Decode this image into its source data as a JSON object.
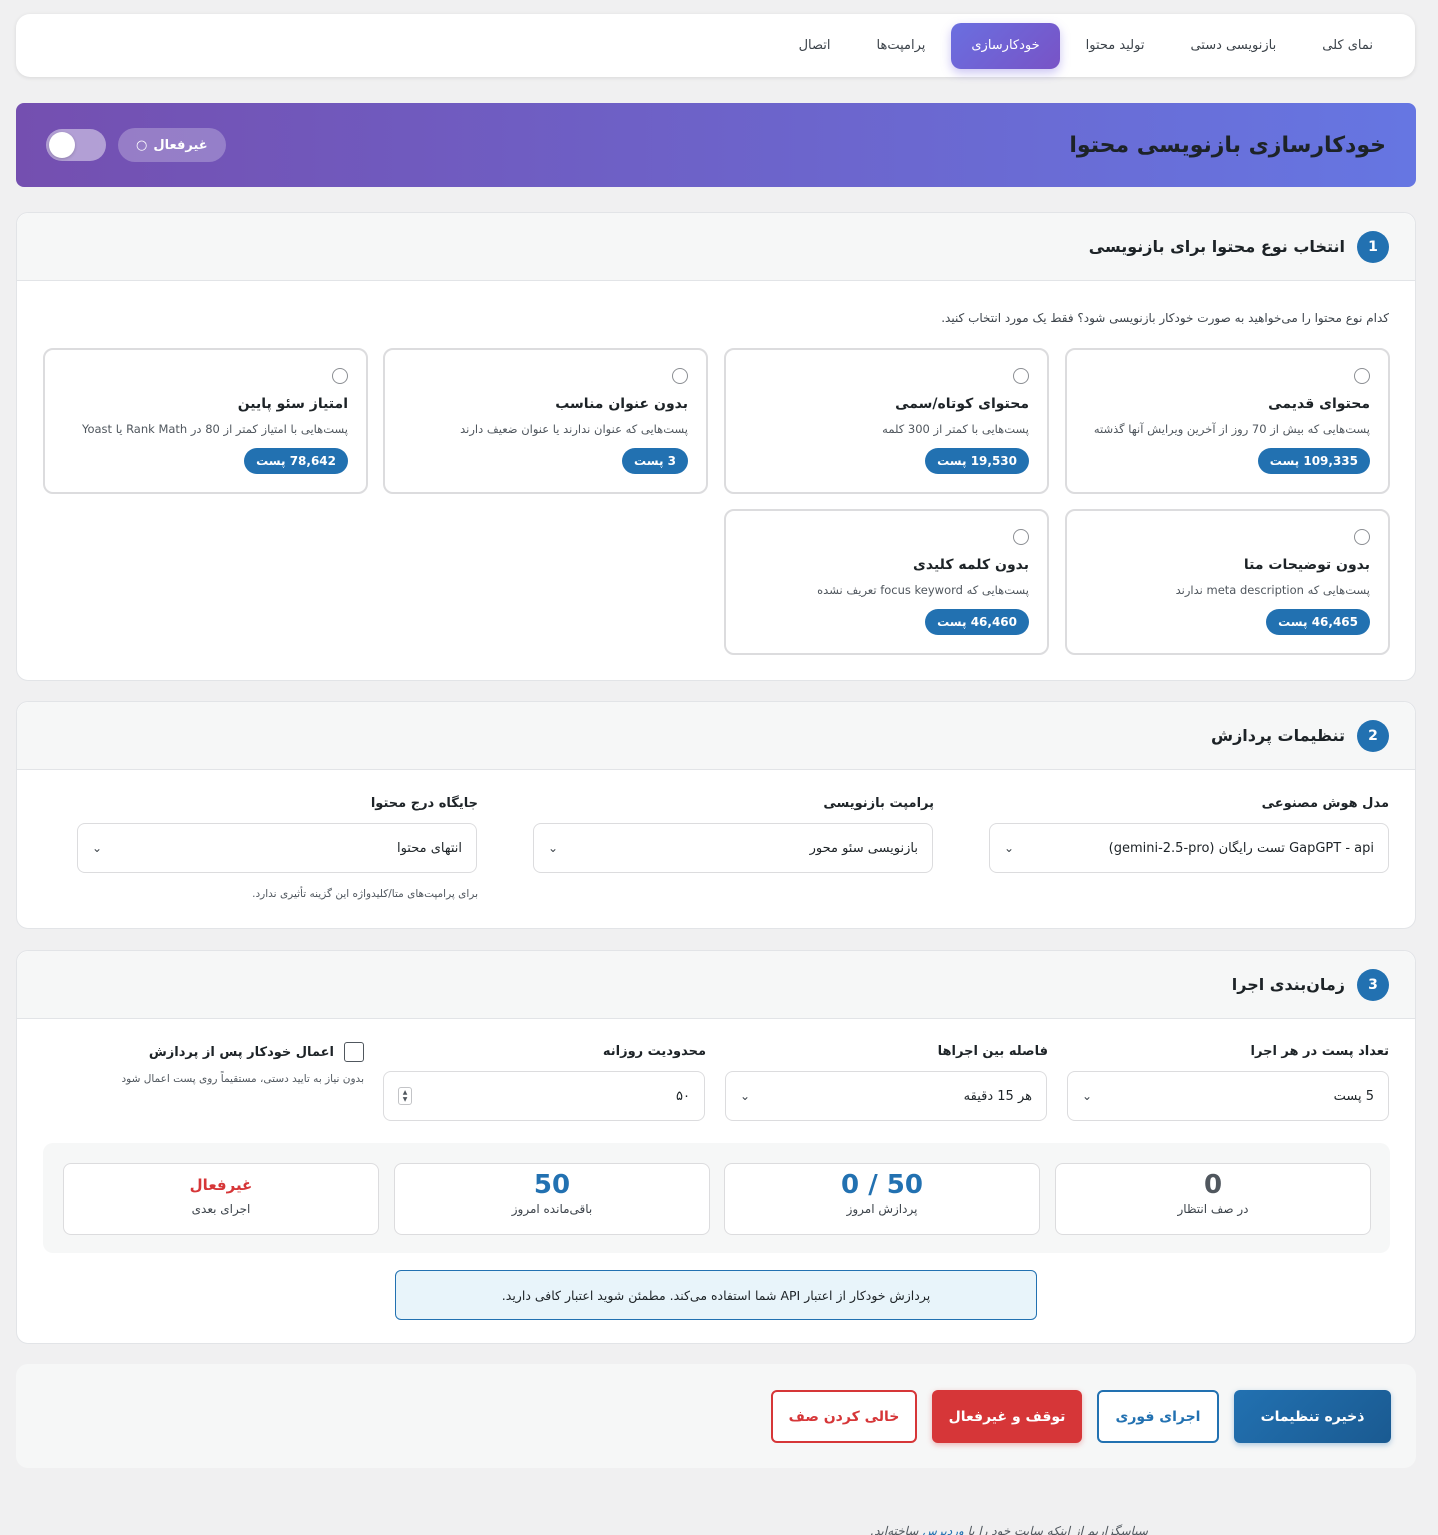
{
  "tabs": [
    {
      "label": "نمای کلی",
      "active": false
    },
    {
      "label": "بازنویسی دستی",
      "active": false
    },
    {
      "label": "تولید محتوا",
      "active": false
    },
    {
      "label": "خودکارسازی",
      "active": true
    },
    {
      "label": "پرامپت‌ها",
      "active": false
    },
    {
      "label": "اتصال",
      "active": false
    }
  ],
  "hero": {
    "title": "خودکارسازی بازنویسی محتوا",
    "status_label": "غیرفعال",
    "status_icon": "○",
    "toggle_on": false
  },
  "section1": {
    "number": "1",
    "title": "انتخاب نوع محتوا برای بازنویسی",
    "intro": "کدام نوع محتوا را می‌خواهید به صورت خودکار بازنویسی شود؟ فقط یک مورد انتخاب کنید.",
    "options": [
      {
        "title": "محتوای قدیمی",
        "desc": "پست‌هایی که بیش از 70 روز از آخرین ویرایش آنها گذشته",
        "badge": "109,335 پست"
      },
      {
        "title": "محتوای کوتاه/سمی",
        "desc": "پست‌هایی با کمتر از 300 کلمه",
        "badge": "19,530 پست"
      },
      {
        "title": "بدون عنوان مناسب",
        "desc": "پست‌هایی که عنوان ندارند یا عنوان ضعیف دارند",
        "badge": "3 پست"
      },
      {
        "title": "امتیاز سئو پایین",
        "desc": "پست‌هایی با امتیاز کمتر از 80 در Rank Math یا Yoast",
        "badge": "78,642 پست"
      },
      {
        "title": "بدون توضیحات متا",
        "desc": "پست‌هایی که meta description ندارند",
        "badge": "46,465 پست"
      },
      {
        "title": "بدون کلمه کلیدی",
        "desc": "پست‌هایی که focus keyword تعریف نشده",
        "badge": "46,460 پست"
      }
    ]
  },
  "section2": {
    "number": "2",
    "title": "تنظیمات پردازش",
    "ai_model": {
      "label": "مدل هوش مصنوعی",
      "value": "GapGPT - api تست رایگان (gemini-2.5-pro)"
    },
    "prompt": {
      "label": "پرامپت بازنویسی",
      "value": "بازنویسی سئو محور"
    },
    "position": {
      "label": "جایگاه درج محتوا",
      "value": "انتهای محتوا",
      "help": "برای پرامپت‌های متا/کلیدواژه این گزینه تأثیری ندارد."
    }
  },
  "section3": {
    "number": "3",
    "title": "زمان‌بندی اجرا",
    "posts_per_run": {
      "label": "تعداد پست در هر اجرا",
      "value": "5 پست"
    },
    "interval": {
      "label": "فاصله بین اجراها",
      "value": "هر 15 دقیقه"
    },
    "daily_limit": {
      "label": "محدودیت روزانه",
      "value": "۵۰"
    },
    "auto_apply": {
      "label": "اعمال خودکار پس از پردازش",
      "help": "بدون نیاز به تایید دستی، مستقیماً روی پست اعمال شود",
      "checked": false
    },
    "stats": [
      {
        "value": "0",
        "label": "در صف انتظار",
        "style": "gray"
      },
      {
        "value": "50 / 0",
        "label": "پردازش امروز",
        "style": "blue"
      },
      {
        "value": "50",
        "label": "باقی‌مانده امروز",
        "style": "blue"
      },
      {
        "value": "غیرفعال",
        "label": "اجرای بعدی",
        "style": "red"
      }
    ],
    "notice": "پردازش خودکار از اعتبار API شما استفاده می‌کند. مطمئن شوید اعتبار کافی دارید."
  },
  "actions": {
    "save": "ذخیره تنظیمات",
    "run_now": "اجرای فوری",
    "stop": "توقف و غیرفعال",
    "clear_queue": "خالی کردن صف"
  },
  "footer": {
    "prefix": "سپاسگزاریم از اینکه سایت خود را با",
    "link": "وردپرس",
    "suffix": "ساخته‌اید."
  },
  "colors": {
    "primary": "#2271b1",
    "danger": "#d63638",
    "hero_from": "#6676e2",
    "hero_to": "#744fb0"
  }
}
